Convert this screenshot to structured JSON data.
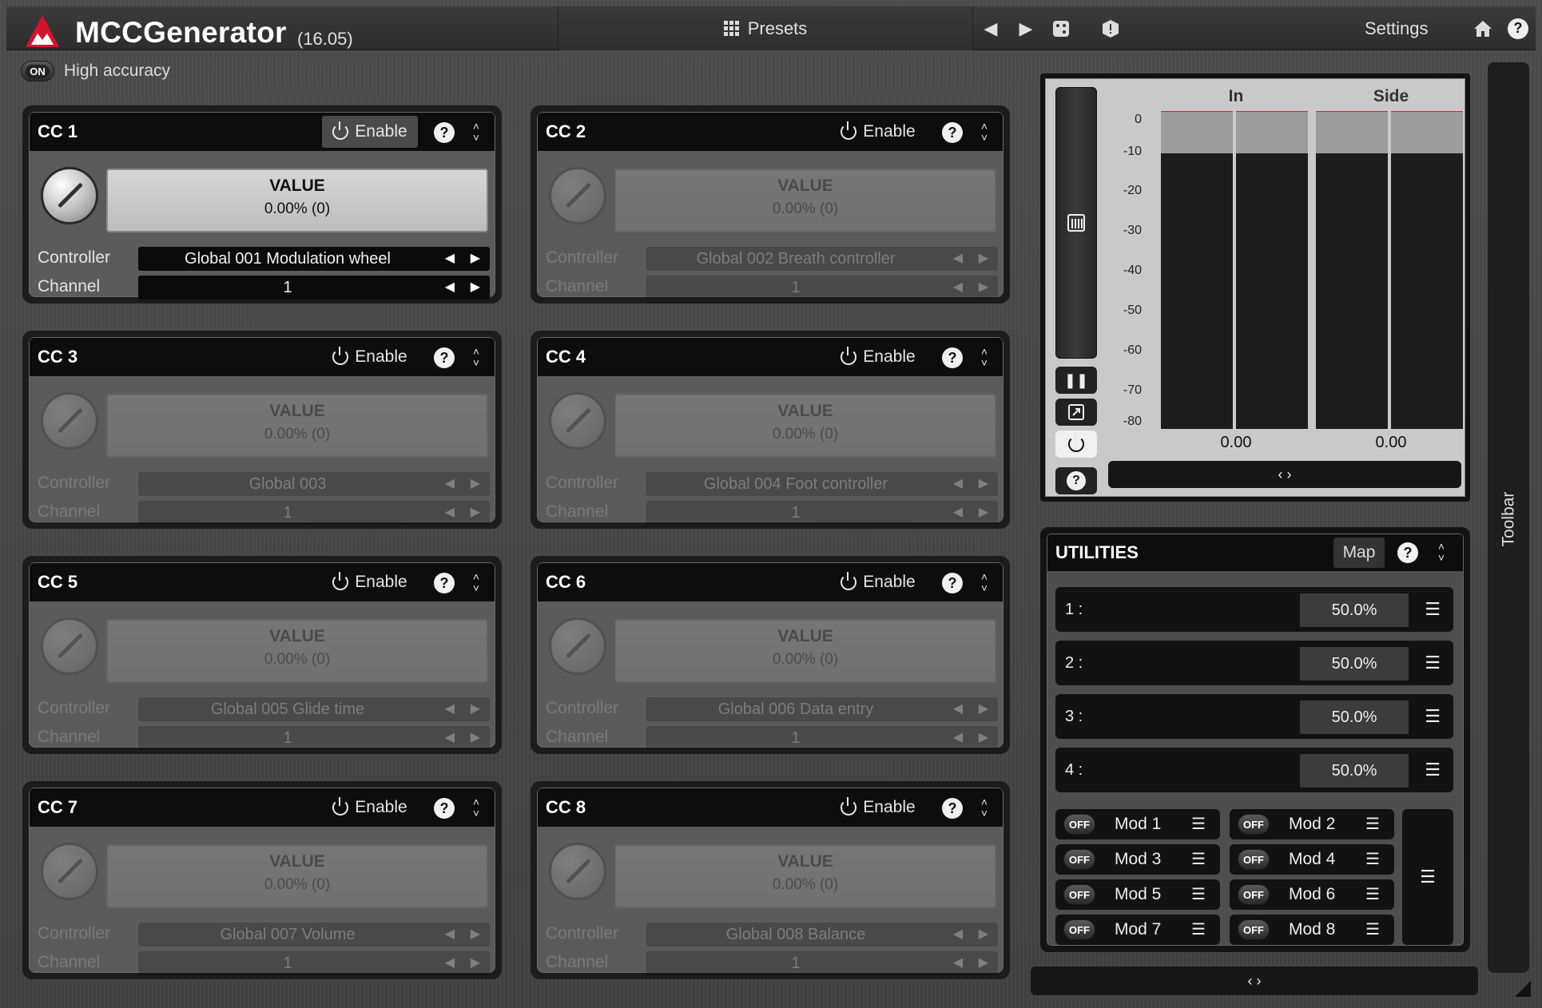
{
  "header": {
    "title": "MCCGenerator",
    "version": "(16.05)",
    "presets_label": "Presets",
    "settings_label": "Settings",
    "icons": [
      "grid-icon",
      "prev-arrow-icon",
      "next-arrow-icon",
      "random-icon",
      "warning-icon",
      "home-icon",
      "help-icon"
    ]
  },
  "high_accuracy": {
    "state": "ON",
    "label": "High accuracy"
  },
  "panels": [
    {
      "title": "CC 1",
      "enable_label": "Enable",
      "enabled": true,
      "value_label": "VALUE",
      "value": "0.00% (0)",
      "controller_label": "Controller",
      "controller": "Global 001 Modulation wheel",
      "channel_label": "Channel",
      "channel": "1"
    },
    {
      "title": "CC 2",
      "enable_label": "Enable",
      "enabled": false,
      "value_label": "VALUE",
      "value": "0.00% (0)",
      "controller_label": "Controller",
      "controller": "Global 002 Breath controller",
      "channel_label": "Channel",
      "channel": "1"
    },
    {
      "title": "CC 3",
      "enable_label": "Enable",
      "enabled": false,
      "value_label": "VALUE",
      "value": "0.00% (0)",
      "controller_label": "Controller",
      "controller": "Global 003",
      "channel_label": "Channel",
      "channel": "1"
    },
    {
      "title": "CC 4",
      "enable_label": "Enable",
      "enabled": false,
      "value_label": "VALUE",
      "value": "0.00% (0)",
      "controller_label": "Controller",
      "controller": "Global 004 Foot controller",
      "channel_label": "Channel",
      "channel": "1"
    },
    {
      "title": "CC 5",
      "enable_label": "Enable",
      "enabled": false,
      "value_label": "VALUE",
      "value": "0.00% (0)",
      "controller_label": "Controller",
      "controller": "Global 005 Glide time",
      "channel_label": "Channel",
      "channel": "1"
    },
    {
      "title": "CC 6",
      "enable_label": "Enable",
      "enabled": false,
      "value_label": "VALUE",
      "value": "0.00% (0)",
      "controller_label": "Controller",
      "controller": "Global 006 Data entry",
      "channel_label": "Channel",
      "channel": "1"
    },
    {
      "title": "CC 7",
      "enable_label": "Enable",
      "enabled": false,
      "value_label": "VALUE",
      "value": "0.00% (0)",
      "controller_label": "Controller",
      "controller": "Global 007 Volume",
      "channel_label": "Channel",
      "channel": "1"
    },
    {
      "title": "CC 8",
      "enable_label": "Enable",
      "enabled": false,
      "value_label": "VALUE",
      "value": "0.00% (0)",
      "controller_label": "Controller",
      "controller": "Global 008 Balance",
      "channel_label": "Channel",
      "channel": "1"
    }
  ],
  "meter": {
    "col_in": "In",
    "col_side": "Side",
    "db_ticks": [
      "0",
      "-10",
      "-20",
      "-30",
      "-40",
      "-50",
      "-60",
      "-70",
      "-80"
    ],
    "in_value": "0.00",
    "side_value": "0.00",
    "scroll_label": "‹ ›"
  },
  "utilities": {
    "title": "UTILITIES",
    "map_label": "Map",
    "rows": [
      {
        "label": "1 :",
        "value": "50.0%"
      },
      {
        "label": "2 :",
        "value": "50.0%"
      },
      {
        "label": "3 :",
        "value": "50.0%"
      },
      {
        "label": "4 :",
        "value": "50.0%"
      }
    ],
    "mods": [
      {
        "state": "OFF",
        "label": "Mod 1"
      },
      {
        "state": "OFF",
        "label": "Mod 2"
      },
      {
        "state": "OFF",
        "label": "Mod 3"
      },
      {
        "state": "OFF",
        "label": "Mod 4"
      },
      {
        "state": "OFF",
        "label": "Mod 5"
      },
      {
        "state": "OFF",
        "label": "Mod 6"
      },
      {
        "state": "OFF",
        "label": "Mod 7"
      },
      {
        "state": "OFF",
        "label": "Mod 8"
      }
    ],
    "menu_glyph": "☰"
  },
  "bottom_scroll_label": "‹ ›",
  "toolbar_label": "Toolbar",
  "colors": {
    "accent": "#c8102e",
    "panel_bg": "#5b5b5b",
    "header_bg": "#0d0d0d"
  }
}
